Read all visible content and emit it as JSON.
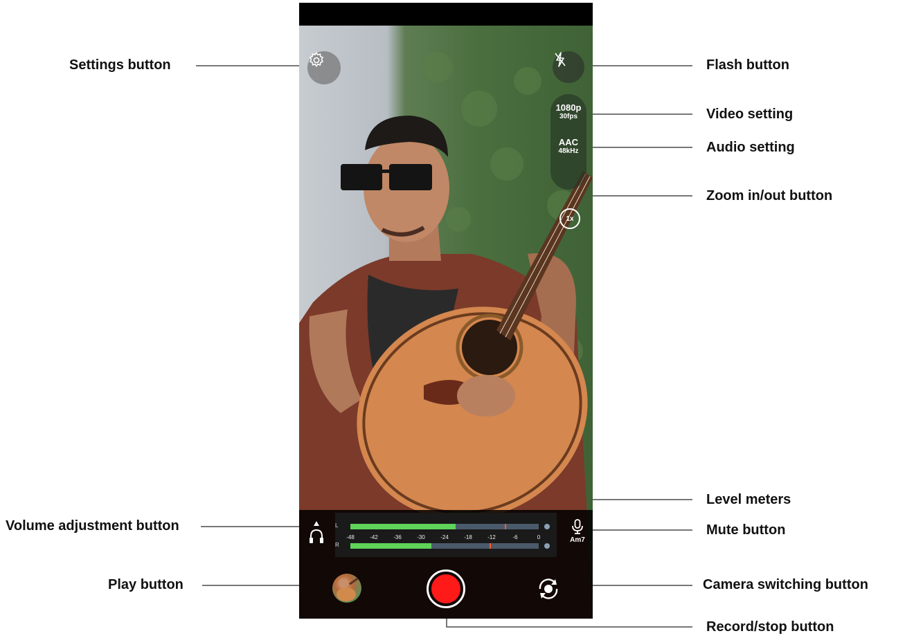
{
  "callouts": {
    "settings": "Settings button",
    "flash": "Flash button",
    "video_setting": "Video setting",
    "audio_setting": "Audio setting",
    "zoom": "Zoom in/out button",
    "level_meters": "Level meters",
    "volume": "Volume adjustment button",
    "mute": "Mute button",
    "play": "Play button",
    "camera_switch": "Camera switching button",
    "record": "Record/stop button"
  },
  "camera": {
    "video": {
      "resolution": "1080p",
      "fps": "30fps"
    },
    "audio": {
      "codec": "AAC",
      "rate": "48kHz"
    },
    "zoom": "1x",
    "chord": "Am7",
    "icons": {
      "settings": "gear-icon",
      "flash": "flash-off-icon",
      "volume": "headphones-icon",
      "mute": "microphone-icon",
      "camera_switch": "camera-switch-icon",
      "record": "record-icon"
    }
  },
  "meters": {
    "left_label": "L",
    "right_label": "R",
    "scale": [
      "-48",
      "-42",
      "-36",
      "-30",
      "-24",
      "-18",
      "-12",
      "-6",
      "0"
    ],
    "left_level": 0.56,
    "right_level": 0.43,
    "left_peak": 0.82,
    "right_peak": 0.74
  },
  "colors": {
    "record": "#ff1a1a",
    "meter_green": "#5fd35a",
    "meter_yellow": "#c9b23a",
    "meter_orange": "#d7862f",
    "peak": "#ff5a2a"
  }
}
